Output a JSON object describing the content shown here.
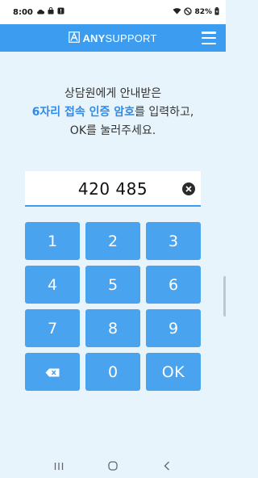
{
  "status_bar": {
    "time": "8:00",
    "battery": "82%"
  },
  "header": {
    "logo_mark": "A",
    "logo_bold": "ANY",
    "logo_rest": "SUPPORT"
  },
  "instruction": {
    "line1": "상담원에게 안내받은",
    "line2_highlight": "6자리 접속 인증 암호",
    "line2_rest": "를 입력하고,",
    "line3": "OK를 눌러주세요."
  },
  "code_input": {
    "value": "420 485"
  },
  "keypad": {
    "k1": "1",
    "k2": "2",
    "k3": "3",
    "k4": "4",
    "k5": "5",
    "k6": "6",
    "k7": "7",
    "k8": "8",
    "k9": "9",
    "k0": "0",
    "ok": "OK"
  },
  "colors": {
    "accent": "#3b9cf0",
    "key": "#4aa3ef",
    "background": "#e8f4fc"
  },
  "icons": {
    "status_left": [
      "cloud-icon",
      "shopping-bag-icon",
      "alert-icon"
    ],
    "status_right": [
      "wifi-icon",
      "do-not-disturb-icon",
      "battery-icon"
    ],
    "clear": "clear-icon",
    "backspace": "backspace-icon",
    "menu": "hamburger-menu-icon",
    "nav": [
      "recent-apps-icon",
      "home-icon",
      "back-icon"
    ]
  }
}
